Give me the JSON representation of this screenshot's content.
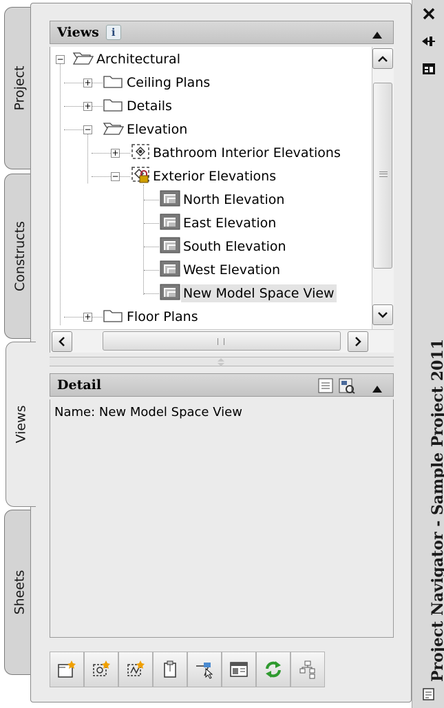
{
  "tabs": [
    {
      "label": "Project"
    },
    {
      "label": "Constructs"
    },
    {
      "label": "Views",
      "active": true
    },
    {
      "label": "Sheets"
    }
  ],
  "views_panel": {
    "title": "Views",
    "info_icon": "info-icon",
    "collapse_icon": "triangle-up-icon"
  },
  "tree": {
    "architectural": "Architectural",
    "ceiling_plans": "Ceiling Plans",
    "details": "Details",
    "elevation": "Elevation",
    "bathroom": "Bathroom Interior Elevations",
    "exterior": "Exterior Elevations",
    "views": [
      "North Elevation",
      "East Elevation",
      "South Elevation",
      "West Elevation",
      "New Model Space View"
    ],
    "floor_plans": "Floor Plans",
    "selected": "New Model Space View"
  },
  "detail_panel": {
    "title": "Detail",
    "name_line": "Name: New Model Space View"
  },
  "side_strip": {
    "title": "Project Navigator - Sample Project 2011",
    "close_icon": "close-icon",
    "autohide_icon": "autohide-icon",
    "properties_icon": "properties-icon"
  },
  "toolbar": {
    "icons": [
      "add-view-icon",
      "add-section-icon",
      "add-detail-icon",
      "add-sheet-icon",
      "select-view-icon",
      "reposition-icon",
      "refresh-icon",
      "regenerate-icon"
    ]
  },
  "colors": {
    "panel_bg": "#ebebeb",
    "header_bg": "#c9c9c9",
    "lock": "#d0a000",
    "refresh_green": "#2f9a2f"
  }
}
